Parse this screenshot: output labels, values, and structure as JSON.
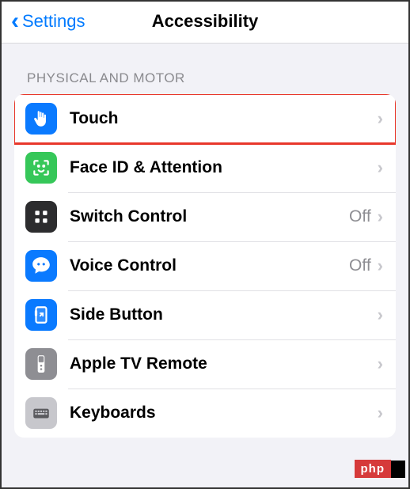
{
  "nav": {
    "back_label": "Settings",
    "title": "Accessibility"
  },
  "section": {
    "header": "PHYSICAL AND MOTOR",
    "rows": [
      {
        "label": "Touch",
        "status": "",
        "highlighted": true
      },
      {
        "label": "Face ID & Attention",
        "status": ""
      },
      {
        "label": "Switch Control",
        "status": "Off"
      },
      {
        "label": "Voice Control",
        "status": "Off"
      },
      {
        "label": "Side Button",
        "status": ""
      },
      {
        "label": "Apple TV Remote",
        "status": ""
      },
      {
        "label": "Keyboards",
        "status": ""
      }
    ]
  },
  "watermark": "php"
}
